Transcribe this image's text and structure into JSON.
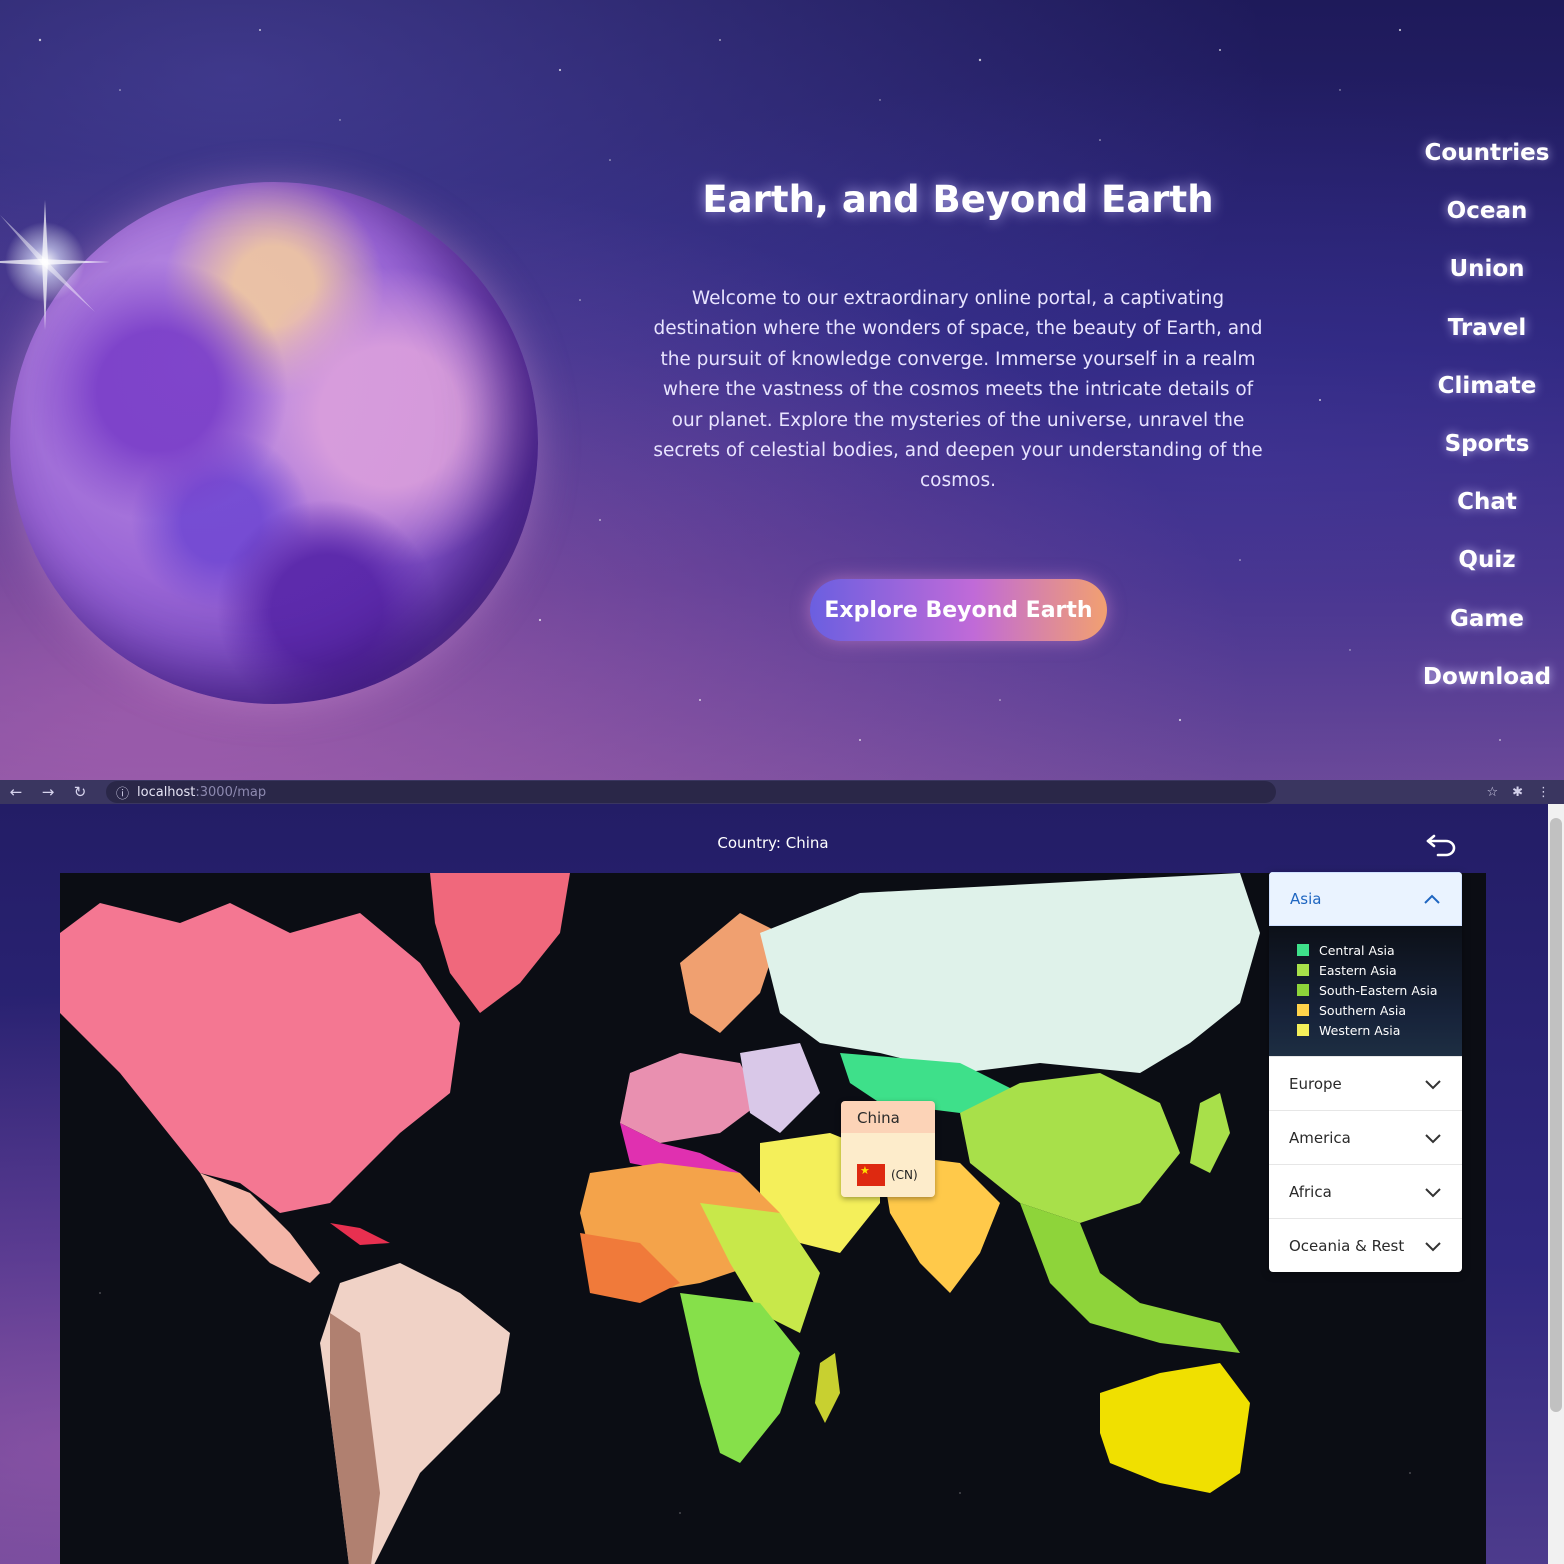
{
  "hero": {
    "title": "Earth, and Beyond Earth",
    "description": "Welcome to our extraordinary online portal, a captivating destination where the wonders of space, the beauty of Earth, and the pursuit of knowledge converge. Immerse yourself in a realm where the vastness of the cosmos meets the intricate details of our planet. Explore the mysteries of the universe, unravel the secrets of celestial bodies, and deepen your understanding of the cosmos.",
    "cta_label": "Explore Beyond Earth"
  },
  "nav": {
    "items": [
      "Countries",
      "Ocean",
      "Union",
      "Travel",
      "Climate",
      "Sports",
      "Chat",
      "Quiz",
      "Game",
      "Download"
    ]
  },
  "browser": {
    "url_host": "localhost",
    "url_path": ":3000/map",
    "icons": [
      "back-arrow-icon",
      "forward-arrow-icon",
      "reload-icon",
      "info-icon",
      "bookmark-star-icon",
      "extensions-icon",
      "menu-dots-icon"
    ]
  },
  "map_page": {
    "country_label": "Country: China",
    "tooltip": {
      "name": "China",
      "code": "(CN)",
      "flag_icon": "china-flag-icon"
    },
    "accordion": {
      "active": "Asia",
      "sections": [
        "Asia",
        "Europe",
        "America",
        "Africa",
        "Oceania & Rest"
      ],
      "legend": [
        {
          "label": "Central Asia",
          "color": "#3ee08a"
        },
        {
          "label": "Eastern Asia",
          "color": "#a8e04a"
        },
        {
          "label": "South-Eastern Asia",
          "color": "#8ed43a"
        },
        {
          "label": "Southern Asia",
          "color": "#ffd34a"
        },
        {
          "label": "Western Asia",
          "color": "#f4ef5a"
        }
      ]
    },
    "colors": {
      "north_america": "#f47792",
      "greenland": "#f0687c",
      "south_america": "#f0d2c6",
      "russia": "#dff2ea",
      "china": "#a8e04a",
      "southern_asia": "#ffc94a",
      "africa_north": "#f4a34a",
      "africa_south": "#86e04a",
      "australia": "#f0e000",
      "europe": "#e990b0"
    }
  }
}
